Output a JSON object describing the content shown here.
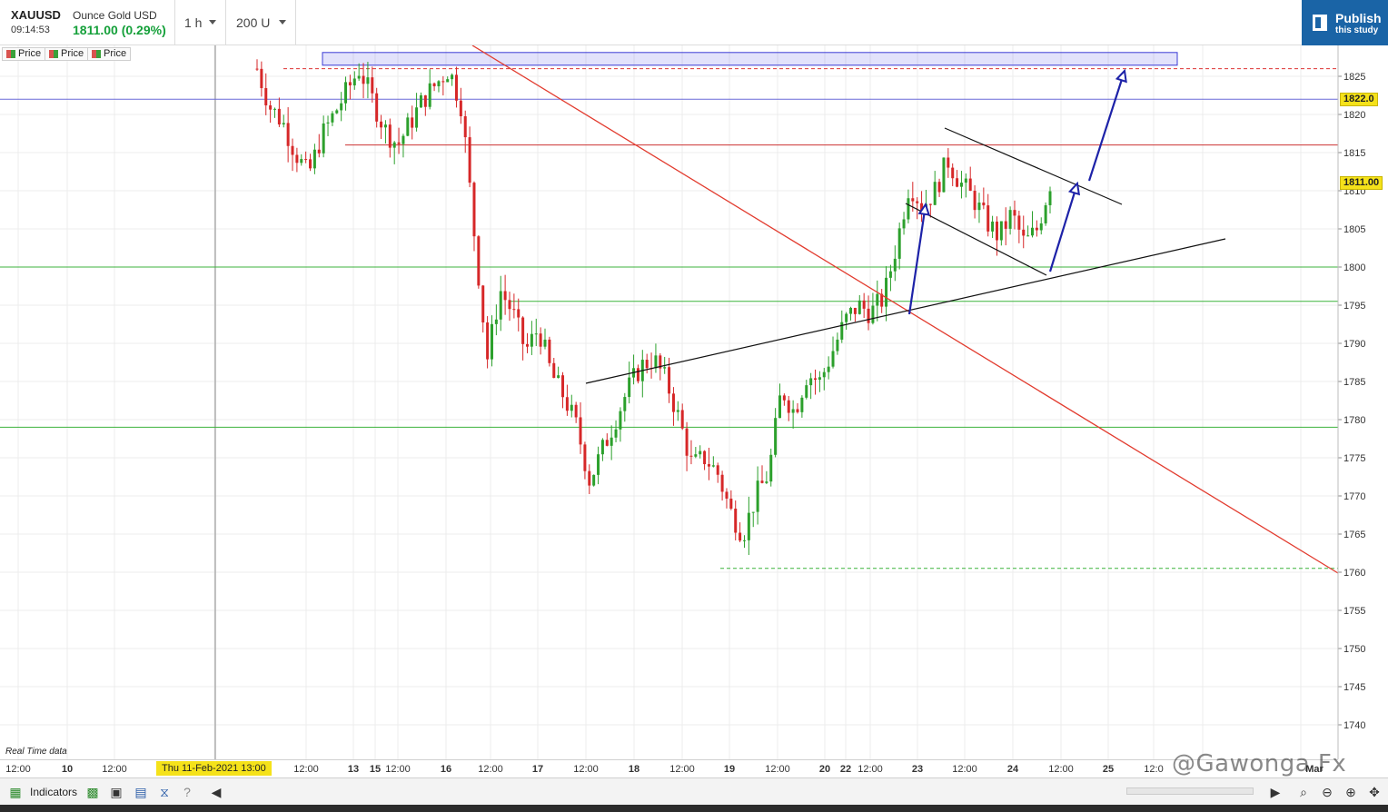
{
  "header": {
    "symbol": "XAUUSD",
    "instrument_name": "Ounce Gold USD",
    "time": "09:14:53",
    "price_change": "1811.00 (0.29%)",
    "interval": "1 h",
    "range": "200 U",
    "publish_line1": "Publish",
    "publish_line2": "this study"
  },
  "legend": [
    "Price",
    "Price",
    "Price"
  ],
  "price_axis": {
    "ticks": [
      "1825",
      "1820",
      "1815",
      "1810",
      "1805",
      "1800",
      "1795",
      "1790",
      "1785",
      "1780",
      "1775",
      "1770",
      "1765",
      "1760",
      "1755",
      "1750",
      "1745",
      "1740"
    ],
    "current_price_tag": "1811.00",
    "hline_tag": "1822.0"
  },
  "time_axis": {
    "labels": [
      "12:00",
      "10",
      "12:00",
      "12:00",
      "13",
      "15",
      "12:00",
      "16",
      "12:00",
      "17",
      "12:00",
      "18",
      "12:00",
      "19",
      "12:00",
      "20",
      "22",
      "12:00",
      "23",
      "12:00",
      "24",
      "12:00",
      "25",
      "12:0",
      "Mar"
    ],
    "cursor_label": "Thu 11-Feb-2021 13:00"
  },
  "realtime_label": "Real Time data",
  "toolbar": {
    "indicators_label": "Indicators"
  },
  "watermark": "@Gawonga Fx",
  "colors": {
    "up_candle": "#2ca02c",
    "down_candle": "#d62728",
    "trendline_red": "#e23b2e",
    "arrow_blue": "#1d22a8",
    "support_green": "#3cb33c",
    "publish_bg": "#1a64a6"
  },
  "chart_data": {
    "type": "candlestick",
    "y_range": [
      1737,
      1830
    ],
    "price_levels": {
      "resistance_zone": [
        1826.5,
        1828
      ],
      "hline_blue": 1822,
      "hline_red": 1816,
      "hline_green_1": 1800,
      "hline_green_2": 1795.5,
      "hline_green_3": 1779,
      "dashed_low": 1760.5
    },
    "close_path": [
      1826,
      1821,
      1819,
      1815,
      1812,
      1817,
      1820,
      1823,
      1826,
      1822,
      1818,
      1816,
      1819,
      1822,
      1824,
      1826,
      1821,
      1804,
      1788,
      1797,
      1794,
      1789,
      1792,
      1786,
      1783,
      1779,
      1772,
      1776,
      1780,
      1784,
      1787,
      1788,
      1785,
      1780,
      1774,
      1775,
      1773,
      1768,
      1765,
      1770,
      1773,
      1784,
      1781,
      1786,
      1785,
      1789,
      1793,
      1795,
      1794,
      1796,
      1803,
      1811,
      1808,
      1810,
      1814,
      1811,
      1809,
      1806,
      1804,
      1807,
      1803,
      1805,
      1811
    ]
  }
}
